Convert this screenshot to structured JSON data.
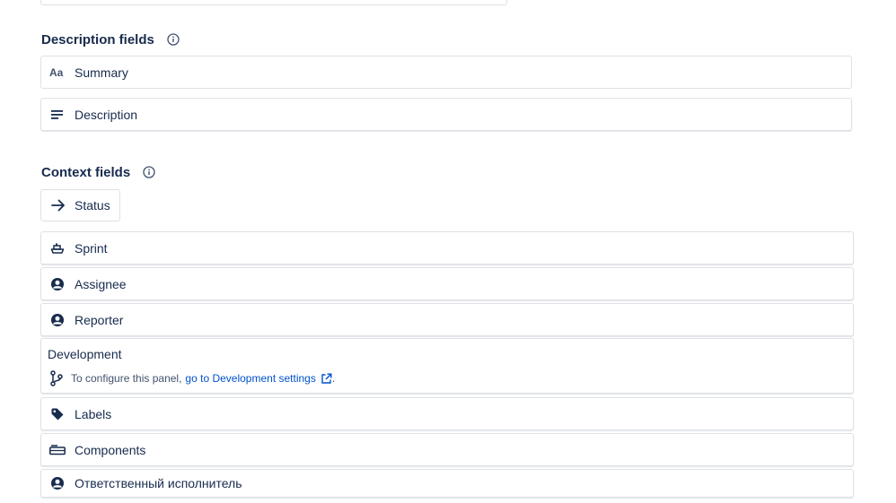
{
  "description_section": {
    "heading": "Description fields",
    "fields": [
      {
        "label": "Summary",
        "icon": "text-aa-icon"
      },
      {
        "label": "Description",
        "icon": "text-lines-icon"
      }
    ]
  },
  "context_section": {
    "heading": "Context fields",
    "status": {
      "label": "Status",
      "icon": "arrow-right-icon"
    },
    "fields": [
      {
        "label": "Sprint",
        "icon": "sprint-boat-icon"
      },
      {
        "label": "Assignee",
        "icon": "user-avatar-icon"
      },
      {
        "label": "Reporter",
        "icon": "user-avatar-icon"
      }
    ],
    "development": {
      "title": "Development",
      "text_prefix": "To configure this panel,",
      "link_text": "go to Development settings",
      "text_suffix": "."
    },
    "fields_after": [
      {
        "label": "Labels",
        "icon": "tag-icon"
      },
      {
        "label": "Components",
        "icon": "component-icon"
      },
      {
        "label": "Ответственный исполнитель",
        "icon": "user-avatar-icon"
      }
    ]
  },
  "colors": {
    "text": "#172b4d",
    "link": "#0052cc",
    "border": "#dfe1e6"
  }
}
